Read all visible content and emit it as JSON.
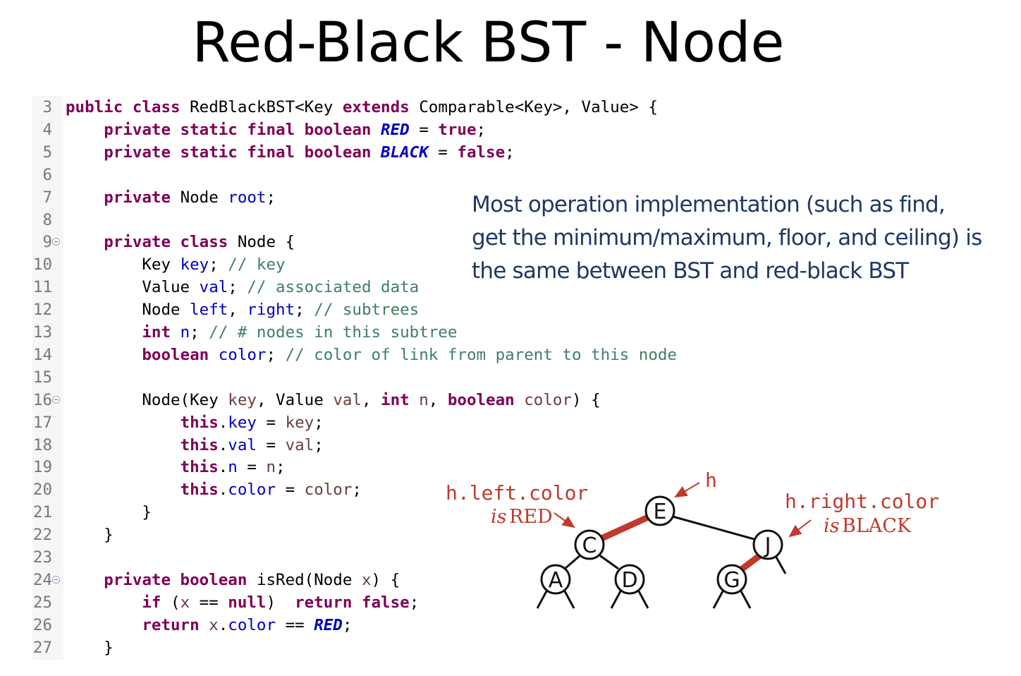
{
  "title": "Red-Black BST - Node",
  "code": {
    "lines": [
      {
        "n": "3",
        "fold": false,
        "tokens": [
          {
            "t": "public class ",
            "c": "kw"
          },
          {
            "t": "RedBlackBST<Key ",
            "c": ""
          },
          {
            "t": "extends ",
            "c": "kw"
          },
          {
            "t": "Comparable<Key>, Value> {",
            "c": ""
          }
        ]
      },
      {
        "n": "4",
        "fold": false,
        "tokens": [
          {
            "t": "    ",
            "c": ""
          },
          {
            "t": "private static final boolean ",
            "c": "kw"
          },
          {
            "t": "RED",
            "c": "cst"
          },
          {
            "t": " = ",
            "c": ""
          },
          {
            "t": "true",
            "c": "kw"
          },
          {
            "t": ";",
            "c": ""
          }
        ]
      },
      {
        "n": "5",
        "fold": false,
        "tokens": [
          {
            "t": "    ",
            "c": ""
          },
          {
            "t": "private static final boolean ",
            "c": "kw"
          },
          {
            "t": "BLACK",
            "c": "cst"
          },
          {
            "t": " = ",
            "c": ""
          },
          {
            "t": "false",
            "c": "kw"
          },
          {
            "t": ";",
            "c": ""
          }
        ]
      },
      {
        "n": "6",
        "fold": false,
        "tokens": []
      },
      {
        "n": "7",
        "fold": false,
        "tokens": [
          {
            "t": "    ",
            "c": ""
          },
          {
            "t": "private ",
            "c": "kw"
          },
          {
            "t": "Node ",
            "c": ""
          },
          {
            "t": "root",
            "c": "fld"
          },
          {
            "t": ";",
            "c": ""
          }
        ]
      },
      {
        "n": "8",
        "fold": false,
        "tokens": []
      },
      {
        "n": "9",
        "fold": true,
        "tokens": [
          {
            "t": "    ",
            "c": ""
          },
          {
            "t": "private class ",
            "c": "kw"
          },
          {
            "t": "Node {",
            "c": ""
          }
        ]
      },
      {
        "n": "10",
        "fold": false,
        "tokens": [
          {
            "t": "        Key ",
            "c": ""
          },
          {
            "t": "key",
            "c": "fld"
          },
          {
            "t": "; ",
            "c": ""
          },
          {
            "t": "// key",
            "c": "cm"
          }
        ]
      },
      {
        "n": "11",
        "fold": false,
        "tokens": [
          {
            "t": "        Value ",
            "c": ""
          },
          {
            "t": "val",
            "c": "fld"
          },
          {
            "t": "; ",
            "c": ""
          },
          {
            "t": "// associated data",
            "c": "cm"
          }
        ]
      },
      {
        "n": "12",
        "fold": false,
        "tokens": [
          {
            "t": "        Node ",
            "c": ""
          },
          {
            "t": "left",
            "c": "fld"
          },
          {
            "t": ", ",
            "c": ""
          },
          {
            "t": "right",
            "c": "fld"
          },
          {
            "t": "; ",
            "c": ""
          },
          {
            "t": "// subtrees",
            "c": "cm"
          }
        ]
      },
      {
        "n": "13",
        "fold": false,
        "tokens": [
          {
            "t": "        ",
            "c": ""
          },
          {
            "t": "int ",
            "c": "kw"
          },
          {
            "t": "n",
            "c": "fld"
          },
          {
            "t": "; ",
            "c": ""
          },
          {
            "t": "// # nodes in this subtree",
            "c": "cm"
          }
        ]
      },
      {
        "n": "14",
        "fold": false,
        "tokens": [
          {
            "t": "        ",
            "c": ""
          },
          {
            "t": "boolean ",
            "c": "kw"
          },
          {
            "t": "color",
            "c": "fld"
          },
          {
            "t": "; ",
            "c": ""
          },
          {
            "t": "// color of link from parent to this node",
            "c": "cm"
          }
        ]
      },
      {
        "n": "15",
        "fold": false,
        "tokens": []
      },
      {
        "n": "16",
        "fold": true,
        "tokens": [
          {
            "t": "        Node(Key ",
            "c": ""
          },
          {
            "t": "key",
            "c": "pm"
          },
          {
            "t": ", Value ",
            "c": ""
          },
          {
            "t": "val",
            "c": "pm"
          },
          {
            "t": ", ",
            "c": ""
          },
          {
            "t": "int ",
            "c": "kw"
          },
          {
            "t": "n",
            "c": "pm"
          },
          {
            "t": ", ",
            "c": ""
          },
          {
            "t": "boolean ",
            "c": "kw"
          },
          {
            "t": "color",
            "c": "pm"
          },
          {
            "t": ") {",
            "c": ""
          }
        ]
      },
      {
        "n": "17",
        "fold": false,
        "tokens": [
          {
            "t": "            ",
            "c": ""
          },
          {
            "t": "this",
            "c": "kw"
          },
          {
            "t": ".",
            "c": ""
          },
          {
            "t": "key",
            "c": "fld"
          },
          {
            "t": " = ",
            "c": ""
          },
          {
            "t": "key",
            "c": "pm"
          },
          {
            "t": ";",
            "c": ""
          }
        ]
      },
      {
        "n": "18",
        "fold": false,
        "tokens": [
          {
            "t": "            ",
            "c": ""
          },
          {
            "t": "this",
            "c": "kw"
          },
          {
            "t": ".",
            "c": ""
          },
          {
            "t": "val",
            "c": "fld"
          },
          {
            "t": " = ",
            "c": ""
          },
          {
            "t": "val",
            "c": "pm"
          },
          {
            "t": ";",
            "c": ""
          }
        ]
      },
      {
        "n": "19",
        "fold": false,
        "tokens": [
          {
            "t": "            ",
            "c": ""
          },
          {
            "t": "this",
            "c": "kw"
          },
          {
            "t": ".",
            "c": ""
          },
          {
            "t": "n",
            "c": "fld"
          },
          {
            "t": " = ",
            "c": ""
          },
          {
            "t": "n",
            "c": "pm"
          },
          {
            "t": ";",
            "c": ""
          }
        ]
      },
      {
        "n": "20",
        "fold": false,
        "tokens": [
          {
            "t": "            ",
            "c": ""
          },
          {
            "t": "this",
            "c": "kw"
          },
          {
            "t": ".",
            "c": ""
          },
          {
            "t": "color",
            "c": "fld"
          },
          {
            "t": " = ",
            "c": ""
          },
          {
            "t": "color",
            "c": "pm"
          },
          {
            "t": ";",
            "c": ""
          }
        ]
      },
      {
        "n": "21",
        "fold": false,
        "tokens": [
          {
            "t": "        }",
            "c": ""
          }
        ]
      },
      {
        "n": "22",
        "fold": false,
        "tokens": [
          {
            "t": "    }",
            "c": ""
          }
        ]
      },
      {
        "n": "23",
        "fold": false,
        "tokens": []
      },
      {
        "n": "24",
        "fold": true,
        "tokens": [
          {
            "t": "    ",
            "c": ""
          },
          {
            "t": "private boolean ",
            "c": "kw"
          },
          {
            "t": "isRed(Node ",
            "c": ""
          },
          {
            "t": "x",
            "c": "pm"
          },
          {
            "t": ") {",
            "c": ""
          }
        ]
      },
      {
        "n": "25",
        "fold": false,
        "tokens": [
          {
            "t": "        ",
            "c": ""
          },
          {
            "t": "if ",
            "c": "kw"
          },
          {
            "t": "(",
            "c": ""
          },
          {
            "t": "x",
            "c": "pm"
          },
          {
            "t": " == ",
            "c": ""
          },
          {
            "t": "null",
            "c": "kw"
          },
          {
            "t": ")  ",
            "c": ""
          },
          {
            "t": "return false",
            "c": "kw"
          },
          {
            "t": ";",
            "c": ""
          }
        ]
      },
      {
        "n": "26",
        "fold": false,
        "tokens": [
          {
            "t": "        ",
            "c": ""
          },
          {
            "t": "return ",
            "c": "kw"
          },
          {
            "t": "x",
            "c": "pm"
          },
          {
            "t": ".",
            "c": ""
          },
          {
            "t": "color",
            "c": "fld"
          },
          {
            "t": " == ",
            "c": ""
          },
          {
            "t": "RED",
            "c": "cst"
          },
          {
            "t": ";",
            "c": ""
          }
        ]
      },
      {
        "n": "27",
        "fold": false,
        "tokens": [
          {
            "t": "    }",
            "c": ""
          }
        ]
      }
    ]
  },
  "note": {
    "lines": [
      "Most operation implementation (such as  find,",
      "get the minimum/maximum, floor, and ceiling) is",
      "the same between BST and red-black BST"
    ]
  },
  "diagram": {
    "nodes": [
      {
        "id": "E",
        "label": "E"
      },
      {
        "id": "C",
        "label": "C"
      },
      {
        "id": "J",
        "label": "J"
      },
      {
        "id": "A",
        "label": "A"
      },
      {
        "id": "D",
        "label": "D"
      },
      {
        "id": "G",
        "label": "G"
      }
    ],
    "links": [
      {
        "from": "E",
        "to": "C",
        "color": "red"
      },
      {
        "from": "E",
        "to": "J",
        "color": "black"
      },
      {
        "from": "C",
        "to": "A",
        "color": "black"
      },
      {
        "from": "C",
        "to": "D",
        "color": "black"
      },
      {
        "from": "J",
        "to": "G",
        "color": "red"
      }
    ],
    "labels": {
      "h": "h",
      "left_code": "h.left.color",
      "left_is": "is",
      "left_value": "RED",
      "right_code": "h.right.color",
      "right_is": "is",
      "right_value": "BLACK"
    },
    "colors": {
      "red_link": "#c0392b",
      "black_link": "#111111",
      "annotation": "#c0392b"
    }
  }
}
